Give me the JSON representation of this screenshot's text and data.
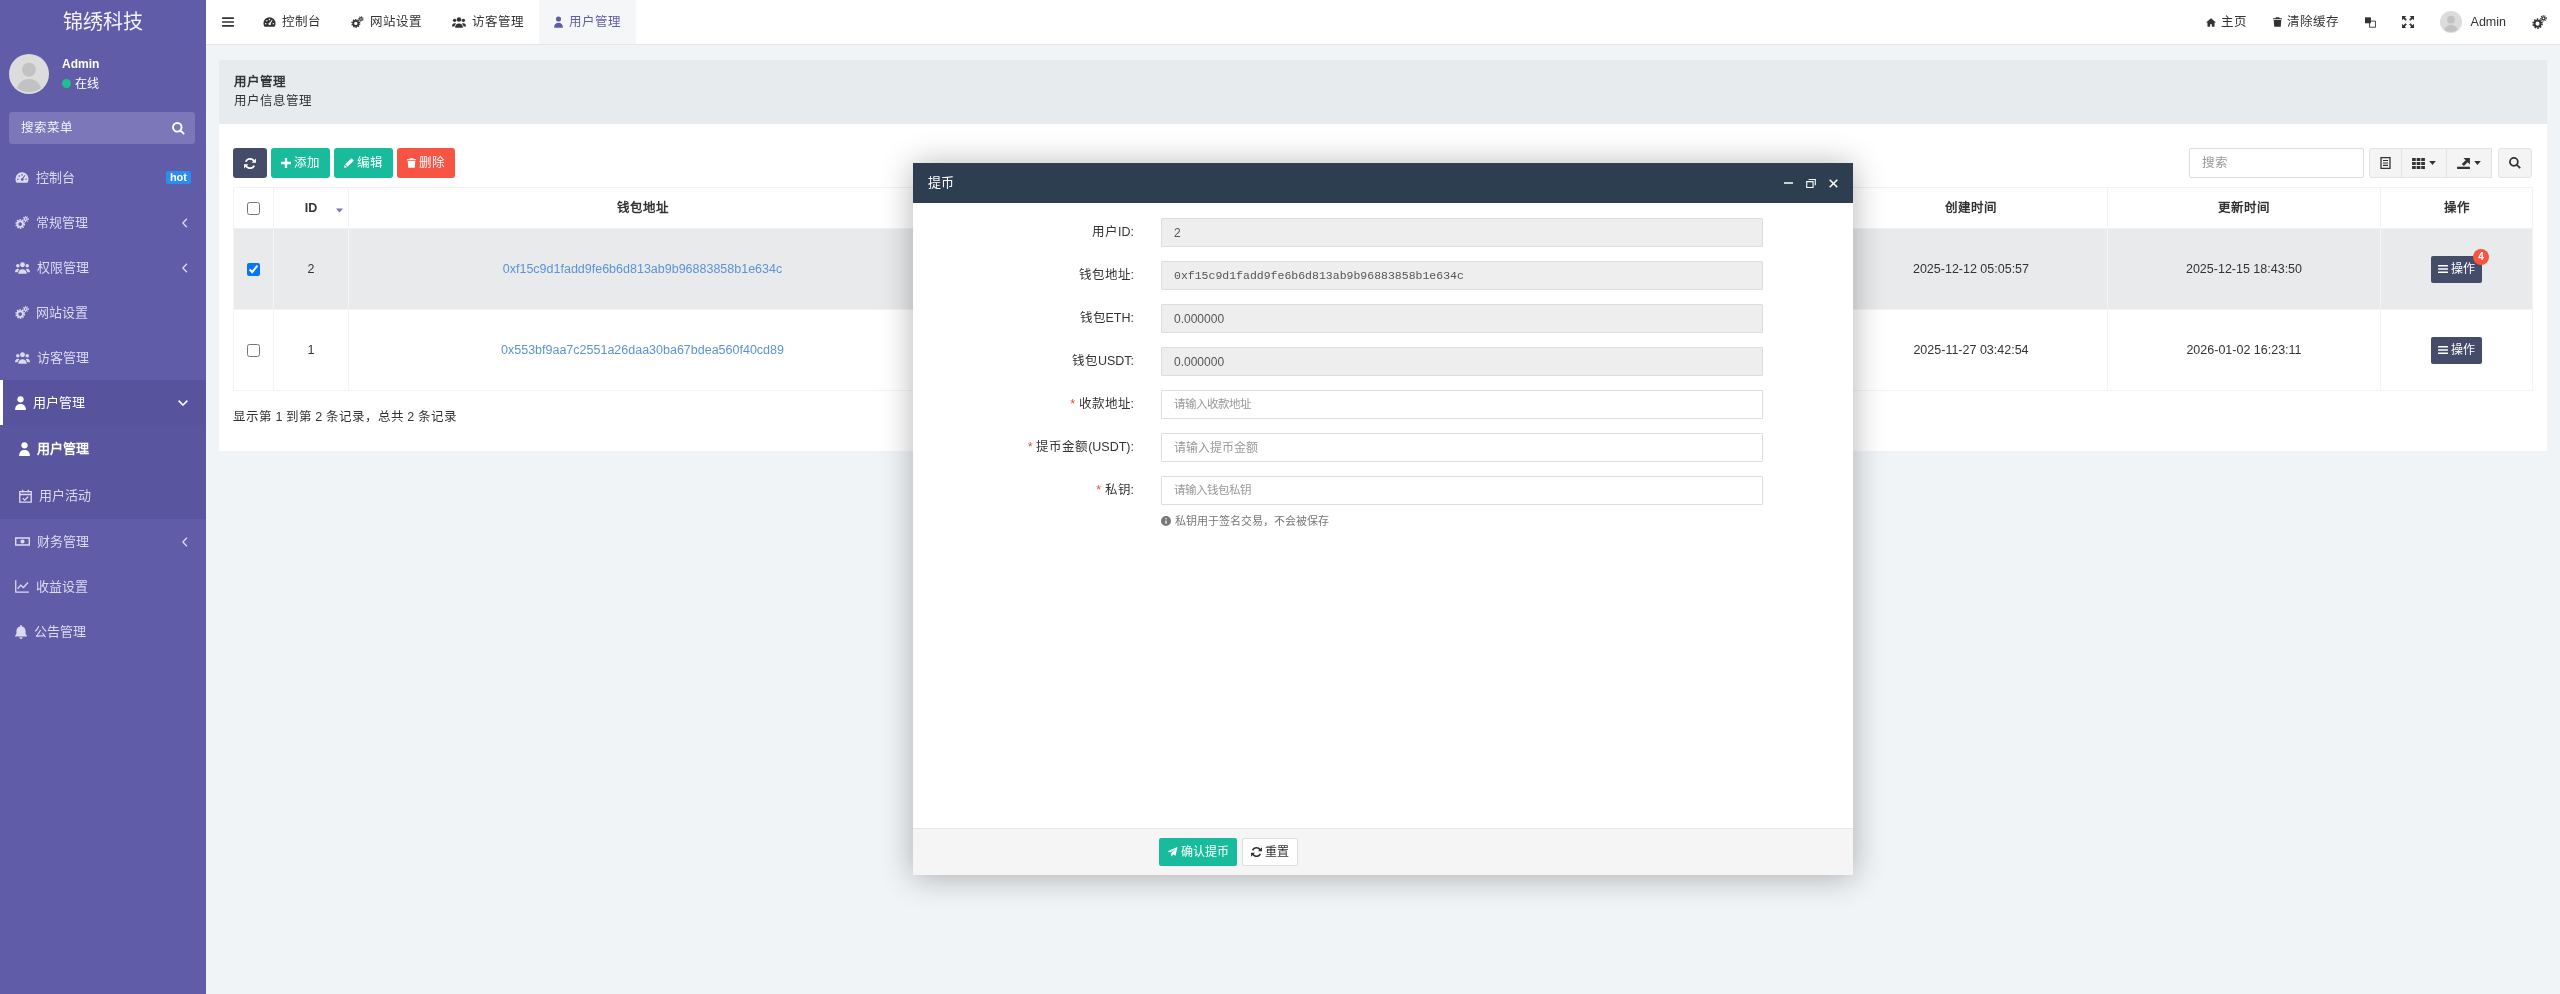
{
  "sidebar": {
    "logo": "锦绣科技",
    "user": {
      "name": "Admin",
      "status": "在线"
    },
    "search": {
      "placeholder": "搜索菜单"
    },
    "items": [
      {
        "label": "控制台",
        "kind": "link",
        "badge": "hot",
        "selected": false,
        "expanded": false
      },
      {
        "label": "常规管理",
        "kind": "group",
        "selected": false,
        "expanded": false
      },
      {
        "label": "权限管理",
        "kind": "group",
        "selected": false,
        "expanded": false
      },
      {
        "label": "网站设置",
        "kind": "link",
        "selected": false,
        "expanded": false
      },
      {
        "label": "访客管理",
        "kind": "link",
        "selected": false,
        "expanded": false
      },
      {
        "label": "用户管理",
        "kind": "group",
        "selected": true,
        "expanded": true,
        "children": [
          {
            "label": "用户管理",
            "selected": true
          },
          {
            "label": "用户活动",
            "selected": false
          }
        ]
      },
      {
        "label": "财务管理",
        "kind": "group",
        "selected": false,
        "expanded": false
      },
      {
        "label": "收益设置",
        "kind": "link",
        "selected": false,
        "expanded": false
      },
      {
        "label": "公告管理",
        "kind": "link",
        "selected": false,
        "expanded": false
      }
    ]
  },
  "topbar": {
    "tabs": [
      {
        "label": "控制台",
        "selected": false
      },
      {
        "label": "网站设置",
        "selected": false
      },
      {
        "label": "访客管理",
        "selected": false
      },
      {
        "label": "用户管理",
        "selected": true
      }
    ],
    "links": [
      {
        "label": "主页"
      },
      {
        "label": "清除缓存"
      }
    ],
    "user": "Admin"
  },
  "page_header": {
    "title": "用户管理",
    "subtitle": "用户信息管理"
  },
  "toolbar": {
    "buttons": [
      {
        "kind": "refresh"
      },
      {
        "kind": "add",
        "label": "添加"
      },
      {
        "kind": "edit",
        "label": "编辑"
      },
      {
        "kind": "delete",
        "label": "删除"
      }
    ],
    "search": {
      "placeholder": "搜索"
    }
  },
  "table": {
    "select_all": false,
    "columns": [
      {
        "label": "ID",
        "kind": "id",
        "sorted": true
      },
      {
        "label": "钱包地址",
        "kind": "link",
        "sorted": false
      },
      {
        "label": "创建时间",
        "kind": "text",
        "sorted": false
      },
      {
        "label": "更新时间",
        "kind": "text",
        "sorted": false
      },
      {
        "label": "操作",
        "kind": "action",
        "sorted": false
      }
    ],
    "rows": [
      {
        "selected": true,
        "cells": [
          "2",
          "0xf15c9d1fadd9fe6b6d813ab9b96883858b1e634c",
          "2025-12-12 05:05:57",
          "2025-12-15 18:43:50",
          "操作"
        ],
        "badge": "4"
      },
      {
        "selected": false,
        "cells": [
          "1",
          "0x553bf9aa7c2551a26daa30ba67bdea560f40cd89",
          "2025-11-27 03:42:54",
          "2026-01-02 16:23:11",
          "操作"
        ]
      }
    ],
    "summary": "显示第 1 到第 2 条记录，总共 2 条记录"
  },
  "dialog": {
    "title": "提币",
    "fields": [
      {
        "label": "用户ID:",
        "kind": "text",
        "readonly": true,
        "value": "2"
      },
      {
        "label": "钱包地址:",
        "kind": "address",
        "readonly": true,
        "value": "0xf15c9d1fadd9fe6b6d813ab9b96883858b1e634c"
      },
      {
        "label": "钱包ETH:",
        "kind": "text",
        "readonly": true,
        "value": "0.000000"
      },
      {
        "label": "钱包USDT:",
        "kind": "text",
        "readonly": true,
        "value": "0.000000"
      },
      {
        "label": "收款地址:",
        "kind": "address",
        "readonly": false,
        "required_mark": "*",
        "placeholder": "请输入收款地址"
      },
      {
        "label": "提币金额(USDT):",
        "kind": "text",
        "readonly": false,
        "required_mark": "*",
        "placeholder": "请输入提币金额"
      },
      {
        "label": "私钥:",
        "kind": "address",
        "readonly": false,
        "required_mark": "*",
        "placeholder": "请输入钱包私钥",
        "help": "私钥用于签名交易，不会被保存"
      }
    ],
    "buttons": [
      {
        "kind": "submit",
        "label": "确认提币"
      },
      {
        "kind": "reset",
        "label": "重置"
      }
    ]
  }
}
